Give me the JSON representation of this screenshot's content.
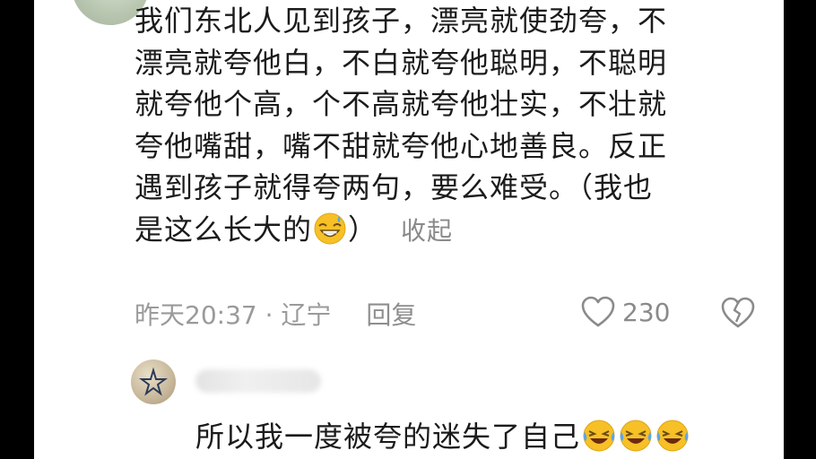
{
  "comment": {
    "lines": [
      "我们东北人见到孩子，漂亮就使劲夸，不",
      "漂亮就夸他白，不白就夸他聪明，不聪明",
      "就夸他个高，个不高就夸他壮实，不壮就",
      "夸他嘴甜，嘴不甜就夸他心地善良。反正",
      "遇到孩子就得夸两句，要么难受。（我也"
    ],
    "last_line_text": "是这么长大的",
    "last_line_close": "）",
    "emoji": "grinning-sweat-emoji",
    "collapse_label": "收起",
    "time": "昨天20:37",
    "separator": " · ",
    "location": "辽宁",
    "reply_label": "回复",
    "like_count": "230"
  },
  "sub_comment": {
    "text": "所以我一度被夸的迷失了自己",
    "emoji": "rolling-on-floor-laughing-emoji",
    "emoji_count": 3
  },
  "colors": {
    "text": "#1b1b1b",
    "muted": "#9a9a9a",
    "emoji_yellow": "#f6c026",
    "emoji_blue": "#5aa7e8"
  }
}
